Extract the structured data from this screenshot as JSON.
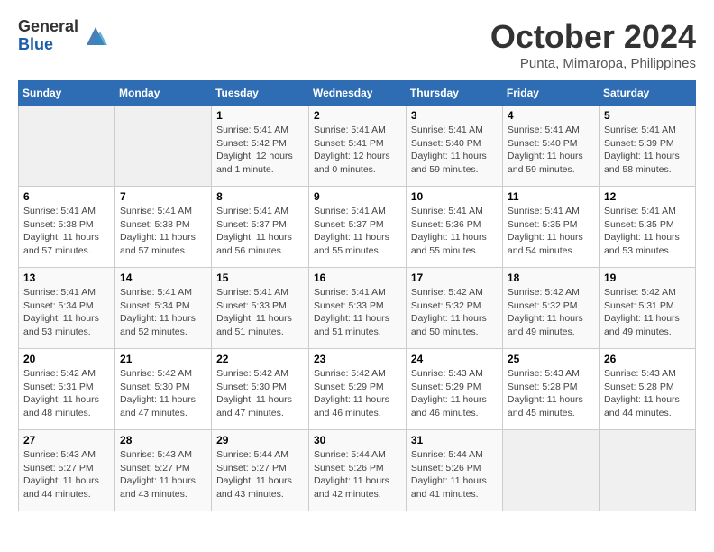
{
  "logo": {
    "general": "General",
    "blue": "Blue"
  },
  "title": "October 2024",
  "subtitle": "Punta, Mimaropa, Philippines",
  "days_of_week": [
    "Sunday",
    "Monday",
    "Tuesday",
    "Wednesday",
    "Thursday",
    "Friday",
    "Saturday"
  ],
  "weeks": [
    [
      {
        "day": "",
        "info": ""
      },
      {
        "day": "",
        "info": ""
      },
      {
        "day": "1",
        "info": "Sunrise: 5:41 AM\nSunset: 5:42 PM\nDaylight: 12 hours\nand 1 minute."
      },
      {
        "day": "2",
        "info": "Sunrise: 5:41 AM\nSunset: 5:41 PM\nDaylight: 12 hours\nand 0 minutes."
      },
      {
        "day": "3",
        "info": "Sunrise: 5:41 AM\nSunset: 5:40 PM\nDaylight: 11 hours\nand 59 minutes."
      },
      {
        "day": "4",
        "info": "Sunrise: 5:41 AM\nSunset: 5:40 PM\nDaylight: 11 hours\nand 59 minutes."
      },
      {
        "day": "5",
        "info": "Sunrise: 5:41 AM\nSunset: 5:39 PM\nDaylight: 11 hours\nand 58 minutes."
      }
    ],
    [
      {
        "day": "6",
        "info": "Sunrise: 5:41 AM\nSunset: 5:38 PM\nDaylight: 11 hours\nand 57 minutes."
      },
      {
        "day": "7",
        "info": "Sunrise: 5:41 AM\nSunset: 5:38 PM\nDaylight: 11 hours\nand 57 minutes."
      },
      {
        "day": "8",
        "info": "Sunrise: 5:41 AM\nSunset: 5:37 PM\nDaylight: 11 hours\nand 56 minutes."
      },
      {
        "day": "9",
        "info": "Sunrise: 5:41 AM\nSunset: 5:37 PM\nDaylight: 11 hours\nand 55 minutes."
      },
      {
        "day": "10",
        "info": "Sunrise: 5:41 AM\nSunset: 5:36 PM\nDaylight: 11 hours\nand 55 minutes."
      },
      {
        "day": "11",
        "info": "Sunrise: 5:41 AM\nSunset: 5:35 PM\nDaylight: 11 hours\nand 54 minutes."
      },
      {
        "day": "12",
        "info": "Sunrise: 5:41 AM\nSunset: 5:35 PM\nDaylight: 11 hours\nand 53 minutes."
      }
    ],
    [
      {
        "day": "13",
        "info": "Sunrise: 5:41 AM\nSunset: 5:34 PM\nDaylight: 11 hours\nand 53 minutes."
      },
      {
        "day": "14",
        "info": "Sunrise: 5:41 AM\nSunset: 5:34 PM\nDaylight: 11 hours\nand 52 minutes."
      },
      {
        "day": "15",
        "info": "Sunrise: 5:41 AM\nSunset: 5:33 PM\nDaylight: 11 hours\nand 51 minutes."
      },
      {
        "day": "16",
        "info": "Sunrise: 5:41 AM\nSunset: 5:33 PM\nDaylight: 11 hours\nand 51 minutes."
      },
      {
        "day": "17",
        "info": "Sunrise: 5:42 AM\nSunset: 5:32 PM\nDaylight: 11 hours\nand 50 minutes."
      },
      {
        "day": "18",
        "info": "Sunrise: 5:42 AM\nSunset: 5:32 PM\nDaylight: 11 hours\nand 49 minutes."
      },
      {
        "day": "19",
        "info": "Sunrise: 5:42 AM\nSunset: 5:31 PM\nDaylight: 11 hours\nand 49 minutes."
      }
    ],
    [
      {
        "day": "20",
        "info": "Sunrise: 5:42 AM\nSunset: 5:31 PM\nDaylight: 11 hours\nand 48 minutes."
      },
      {
        "day": "21",
        "info": "Sunrise: 5:42 AM\nSunset: 5:30 PM\nDaylight: 11 hours\nand 47 minutes."
      },
      {
        "day": "22",
        "info": "Sunrise: 5:42 AM\nSunset: 5:30 PM\nDaylight: 11 hours\nand 47 minutes."
      },
      {
        "day": "23",
        "info": "Sunrise: 5:42 AM\nSunset: 5:29 PM\nDaylight: 11 hours\nand 46 minutes."
      },
      {
        "day": "24",
        "info": "Sunrise: 5:43 AM\nSunset: 5:29 PM\nDaylight: 11 hours\nand 46 minutes."
      },
      {
        "day": "25",
        "info": "Sunrise: 5:43 AM\nSunset: 5:28 PM\nDaylight: 11 hours\nand 45 minutes."
      },
      {
        "day": "26",
        "info": "Sunrise: 5:43 AM\nSunset: 5:28 PM\nDaylight: 11 hours\nand 44 minutes."
      }
    ],
    [
      {
        "day": "27",
        "info": "Sunrise: 5:43 AM\nSunset: 5:27 PM\nDaylight: 11 hours\nand 44 minutes."
      },
      {
        "day": "28",
        "info": "Sunrise: 5:43 AM\nSunset: 5:27 PM\nDaylight: 11 hours\nand 43 minutes."
      },
      {
        "day": "29",
        "info": "Sunrise: 5:44 AM\nSunset: 5:27 PM\nDaylight: 11 hours\nand 43 minutes."
      },
      {
        "day": "30",
        "info": "Sunrise: 5:44 AM\nSunset: 5:26 PM\nDaylight: 11 hours\nand 42 minutes."
      },
      {
        "day": "31",
        "info": "Sunrise: 5:44 AM\nSunset: 5:26 PM\nDaylight: 11 hours\nand 41 minutes."
      },
      {
        "day": "",
        "info": ""
      },
      {
        "day": "",
        "info": ""
      }
    ]
  ]
}
